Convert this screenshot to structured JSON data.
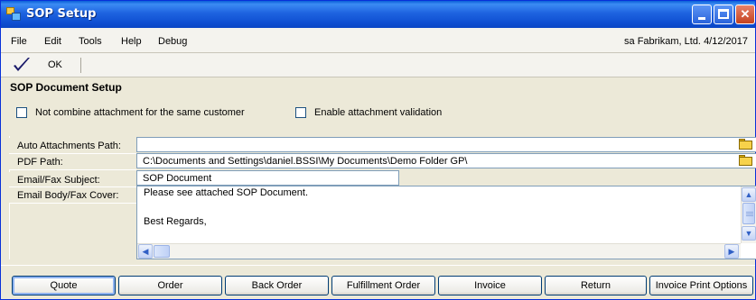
{
  "window": {
    "title": "SOP Setup"
  },
  "menu": {
    "items": [
      "File",
      "Edit",
      "Tools",
      "Help",
      "Debug"
    ],
    "user": "sa",
    "company": "Fabrikam, Ltd.",
    "date": "4/12/2017"
  },
  "toolbar": {
    "ok_label": "OK",
    "ok_icon": "checkmark-icon"
  },
  "form": {
    "section_title": "SOP Document Setup",
    "checkbox_not_combine": {
      "label": "Not combine attachment for the same customer",
      "checked": false
    },
    "checkbox_enable_validation": {
      "label": "Enable attachment validation",
      "checked": false
    },
    "auto_attachments_path": {
      "label": "Auto Attachments Path:",
      "value": ""
    },
    "pdf_path": {
      "label": "PDF Path:",
      "value": "C:\\Documents and Settings\\daniel.BSSI\\My Documents\\Demo Folder GP\\"
    },
    "email_subject": {
      "label": "Email/Fax Subject:",
      "value": "SOP Document"
    },
    "email_body": {
      "label": "Email Body/Fax Cover:",
      "lines": [
        "Please see attached SOP Document.",
        "",
        "Best Regards,"
      ]
    }
  },
  "buttons": [
    "Quote",
    "Order",
    "Back Order",
    "Fulfillment Order",
    "Invoice",
    "Return",
    "Invoice Print Options"
  ],
  "colors": {
    "titlebar": "#0f4fd2",
    "window_bg": "#ece9d8",
    "button_border": "#003c74"
  }
}
